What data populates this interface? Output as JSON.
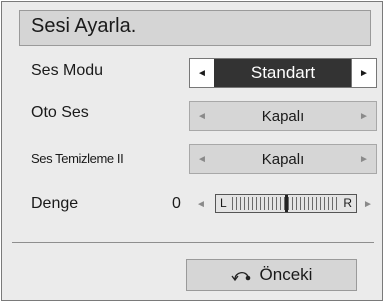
{
  "title": "Sesi Ayarla.",
  "rows": [
    {
      "label": "Ses Modu",
      "value": "Standart"
    },
    {
      "label": "Oto Ses",
      "value": "Kapalı"
    },
    {
      "label": "Ses Temizleme II",
      "value": "Kapalı"
    }
  ],
  "balance": {
    "label": "Denge",
    "value": "0",
    "left_label": "L",
    "right_label": "R",
    "position": 0.5
  },
  "footer": {
    "prev_label": "Önceki"
  },
  "icons": {
    "left": "left-arrow-icon",
    "right": "right-arrow-icon",
    "back": "back-return-icon"
  },
  "glyphs": {
    "left_arrow": "◄",
    "right_arrow": "►"
  },
  "colors": {
    "panel_bg": "#ebebeb",
    "active_value_bg": "#333333",
    "active_value_text": "#ffffff"
  }
}
